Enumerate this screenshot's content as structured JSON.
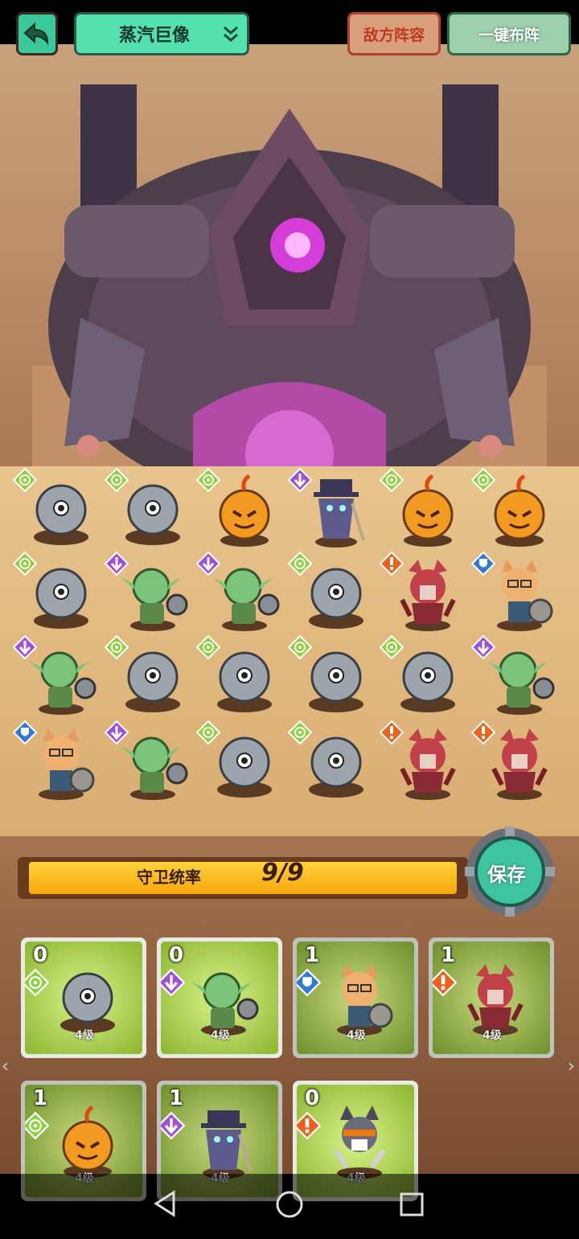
{
  "header": {
    "title": "蒸汽巨像",
    "enemy_lineup": "敌方阵容",
    "auto_deploy": "一键布阵"
  },
  "leadership": {
    "label": "守卫统率",
    "value": "9/9",
    "fill_fraction": 1.0,
    "save_label": "保存"
  },
  "colors": {
    "accent_green": "#55e0b0",
    "enemy_red": "#c23820",
    "bar_gold": "#f5a70d"
  },
  "board": {
    "rows": [
      [
        {
          "unit": "eye-orb",
          "badge": "target"
        },
        {
          "unit": "eye-orb",
          "badge": "target"
        },
        {
          "unit": "pumpkin",
          "badge": "target"
        },
        {
          "unit": "plague-doctor",
          "badge": "arrow"
        },
        {
          "unit": "pumpkin",
          "badge": "target"
        },
        {
          "unit": "pumpkin",
          "badge": "target"
        }
      ],
      [
        {
          "unit": "eye-orb",
          "badge": "target"
        },
        {
          "unit": "goblin",
          "badge": "arrow"
        },
        {
          "unit": "goblin",
          "badge": "arrow"
        },
        {
          "unit": "eye-orb",
          "badge": "target"
        },
        {
          "unit": "werewolf",
          "badge": "alert"
        },
        {
          "unit": "cat-knight",
          "badge": "shield"
        }
      ],
      [
        {
          "unit": "goblin",
          "badge": "arrow"
        },
        {
          "unit": "eye-orb",
          "badge": "target"
        },
        {
          "unit": "eye-orb",
          "badge": "target"
        },
        {
          "unit": "eye-orb",
          "badge": "target"
        },
        {
          "unit": "eye-orb",
          "badge": "target"
        },
        {
          "unit": "goblin",
          "badge": "arrow"
        }
      ],
      [
        {
          "unit": "cat-knight",
          "badge": "shield"
        },
        {
          "unit": "goblin",
          "badge": "arrow"
        },
        {
          "unit": "eye-orb",
          "badge": "target"
        },
        {
          "unit": "eye-orb",
          "badge": "target"
        },
        {
          "unit": "werewolf",
          "badge": "alert"
        },
        {
          "unit": "werewolf",
          "badge": "alert"
        }
      ]
    ]
  },
  "cards": [
    {
      "cost": "0",
      "level": "4级",
      "unit": "eye-orb",
      "badge": "target",
      "dimmed": false
    },
    {
      "cost": "0",
      "level": "4级",
      "unit": "goblin",
      "badge": "arrow",
      "dimmed": false
    },
    {
      "cost": "1",
      "level": "4级",
      "unit": "cat-knight",
      "badge": "shield",
      "dimmed": true
    },
    {
      "cost": "1",
      "level": "4级",
      "unit": "werewolf",
      "badge": "alert",
      "dimmed": true
    },
    {
      "cost": "1",
      "level": "4级",
      "unit": "pumpkin",
      "badge": "target",
      "dimmed": true
    },
    {
      "cost": "1",
      "level": "4级",
      "unit": "plague-doctor",
      "badge": "arrow",
      "dimmed": true
    },
    {
      "cost": "0",
      "level": "4级",
      "unit": "wolf-king",
      "badge": "alert",
      "dimmed": false
    }
  ]
}
